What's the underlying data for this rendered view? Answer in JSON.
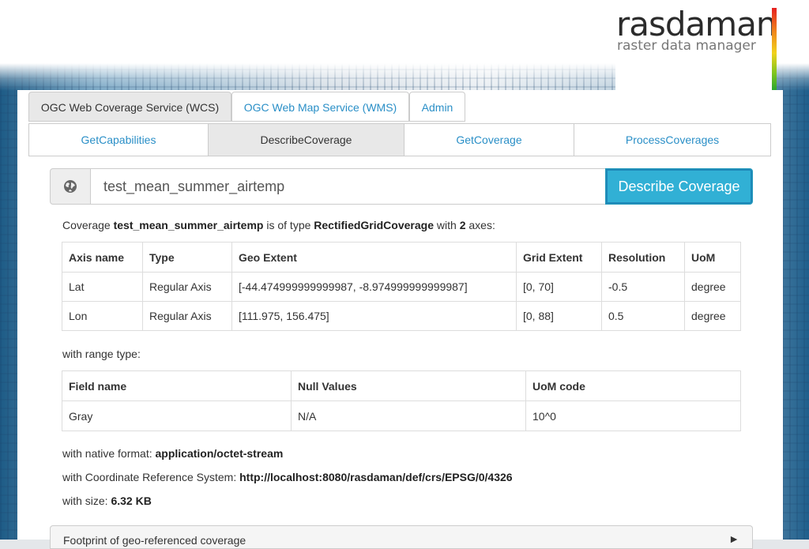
{
  "logo": {
    "name": "rasdaman",
    "tagline": "raster data manager"
  },
  "tabs": [
    {
      "label": "OGC Web Coverage Service (WCS)",
      "active": true
    },
    {
      "label": "OGC Web Map Service (WMS)",
      "active": false
    },
    {
      "label": "Admin",
      "active": false
    }
  ],
  "subtabs": [
    {
      "label": "GetCapabilities",
      "active": false
    },
    {
      "label": "DescribeCoverage",
      "active": true
    },
    {
      "label": "GetCoverage",
      "active": false
    },
    {
      "label": "ProcessCoverages",
      "active": false
    }
  ],
  "search": {
    "value": "test_mean_summer_airtemp",
    "icon": "globe-icon",
    "button_label": "Describe Coverage"
  },
  "summary": {
    "prefix": "Coverage ",
    "coverage_id": "test_mean_summer_airtemp",
    "mid1": " is of type ",
    "coverage_type": "RectifiedGridCoverage",
    "mid2": " with ",
    "axes_count": "2",
    "suffix": " axes:"
  },
  "axes_table": {
    "headers": [
      "Axis name",
      "Type",
      "Geo Extent",
      "Grid Extent",
      "Resolution",
      "UoM"
    ],
    "rows": [
      [
        "Lat",
        "Regular Axis",
        "[-44.474999999999987, -8.974999999999987]",
        "[0, 70]",
        "-0.5",
        "degree"
      ],
      [
        "Lon",
        "Regular Axis",
        "[111.975, 156.475]",
        "[0, 88]",
        "0.5",
        "degree"
      ]
    ]
  },
  "range_label": "with range type:",
  "range_table": {
    "headers": [
      "Field name",
      "Null Values",
      "UoM code"
    ],
    "rows": [
      [
        "Gray",
        "N/A",
        "10^0"
      ]
    ]
  },
  "native_format": {
    "label": "with native format: ",
    "value": "application/octet-stream"
  },
  "crs": {
    "label": "with Coordinate Reference System: ",
    "value": "http://localhost:8080/rasdaman/def/crs/EPSG/0/4326"
  },
  "size": {
    "label": "with size: ",
    "value": "6.32 KB"
  },
  "footprint": {
    "label": "Footprint of geo-referenced coverage",
    "icon": "chevron-right-icon"
  }
}
